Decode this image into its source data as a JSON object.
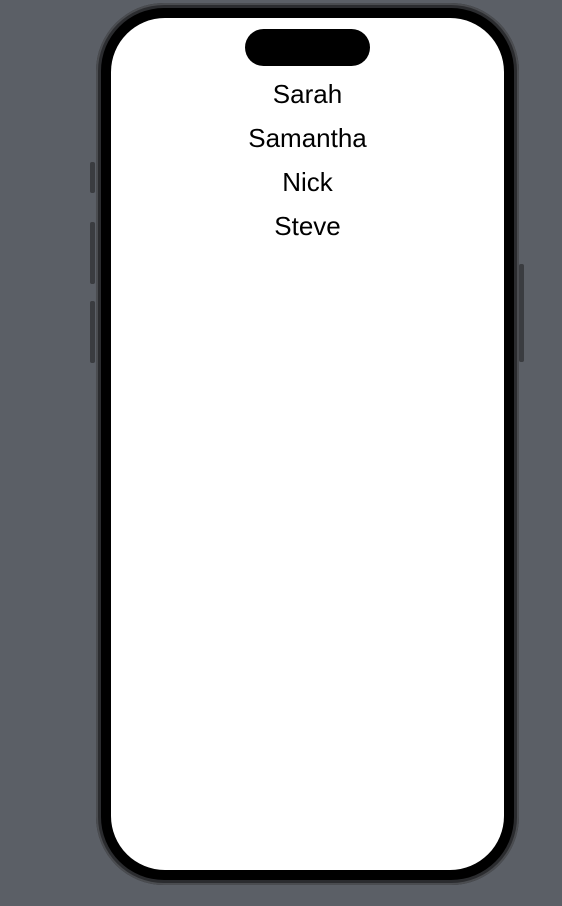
{
  "names": [
    "Sarah",
    "Samantha",
    "Nick",
    "Steve"
  ],
  "colors": {
    "background": "#5b5f66",
    "screen": "#ffffff",
    "text": "#000000"
  }
}
